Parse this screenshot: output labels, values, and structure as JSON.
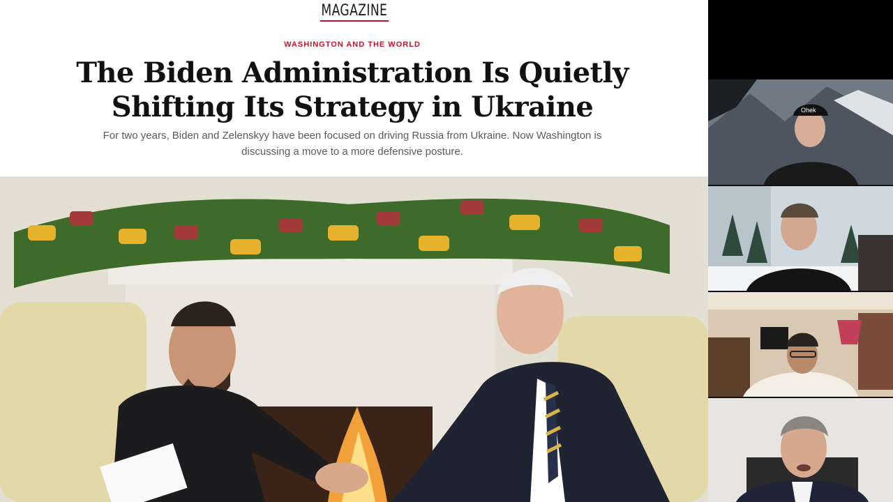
{
  "article": {
    "masthead": "MAGAZINE",
    "kicker": "WASHINGTON AND THE WORLD",
    "headline_line1": "The Biden Administration Is Quietly",
    "headline_line2": "Shifting Its Strategy in Ukraine",
    "dek_line1": "For two years, Biden and Zelenskyy have been focused on driving Russia from Ukraine. Now Washington is",
    "dek_line2": "discussing a move to a more defensive posture."
  },
  "video_call": {
    "participants": [
      {
        "tile": "participant-1",
        "cap_text": "Ohek"
      },
      {
        "tile": "participant-2"
      },
      {
        "tile": "participant-3"
      },
      {
        "tile": "participant-4"
      }
    ]
  },
  "colors": {
    "accent_red": "#c8102e",
    "headline": "#111111",
    "dek": "#5a5a5a"
  }
}
